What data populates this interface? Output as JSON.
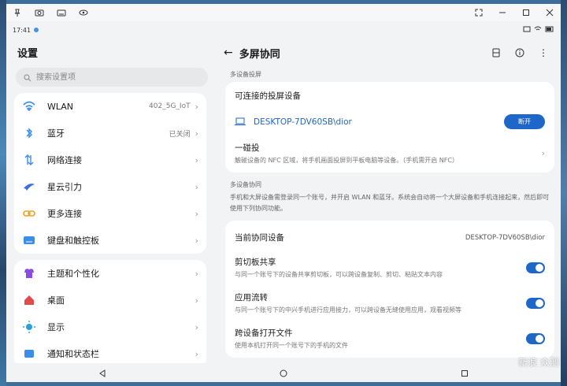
{
  "statusbar": {
    "time": "17:41"
  },
  "left": {
    "title": "设置",
    "search_placeholder": "搜索设置项",
    "group1": [
      {
        "label": "WLAN",
        "value": "402_5G_IoT",
        "icon": "wifi-icon",
        "color": "#3a8ee6"
      },
      {
        "label": "蓝牙",
        "value": "已关闭",
        "icon": "bluetooth-icon",
        "color": "#3a8ee6"
      },
      {
        "label": "网络连接",
        "value": "",
        "icon": "network-icon",
        "color": "#3a8ee6"
      },
      {
        "label": "星云引力",
        "value": "",
        "icon": "nebula-icon",
        "color": "#3a6ee6"
      },
      {
        "label": "更多连接",
        "value": "",
        "icon": "link-icon",
        "color": "#f0a020"
      },
      {
        "label": "键盘和触控板",
        "value": "",
        "icon": "keyboard-icon",
        "color": "#3a8ee6"
      }
    ],
    "group2": [
      {
        "label": "主题和个性化",
        "value": "",
        "icon": "theme-icon",
        "color": "#8a4ce0"
      },
      {
        "label": "桌面",
        "value": "",
        "icon": "home-icon",
        "color": "#e04c4c"
      },
      {
        "label": "显示",
        "value": "",
        "icon": "display-icon",
        "color": "#2aa0d8"
      },
      {
        "label": "通知和状态栏",
        "value": "",
        "icon": "notification-icon",
        "color": "#3a8ee6"
      }
    ]
  },
  "right": {
    "title": "多屏协同",
    "section1_label": "多设备投屏",
    "connectable_title": "可连接的投屏设备",
    "device_name": "DESKTOP-7DV60SB\\dior",
    "disconnect_label": "断开",
    "tap_title": "一碰投",
    "tap_desc": "触碰设备的 NFC 区域，将手机画面投屏到平板电脑等设备。（手机需开启 NFC）",
    "section2_label": "多设备协同",
    "section2_desc": "手机和大屏设备需登录同一个账号，并开启 WLAN 和蓝牙。系统会自动将一个大屏设备和手机连接起来，然后即可使用下列协同功能。",
    "current_label": "当前协同设备",
    "current_value": "DESKTOP-7DV60SB\\dior",
    "features": [
      {
        "title": "剪切板共享",
        "desc": "与同一个账号下的设备共享剪切板，可以跨设备复制、剪切、粘贴文本内容",
        "enabled": true
      },
      {
        "title": "应用流转",
        "desc": "与同一个账号下的中兴手机进行应用接力，可以跨设备无缝使用应用，观看视频等",
        "enabled": true
      },
      {
        "title": "跨设备打开文件",
        "desc": "使用本机打开同一个账号下的手机的文件",
        "enabled": true
      }
    ]
  },
  "watermark": "新浪 众测",
  "colors": {
    "accent": "#1e66c8"
  }
}
